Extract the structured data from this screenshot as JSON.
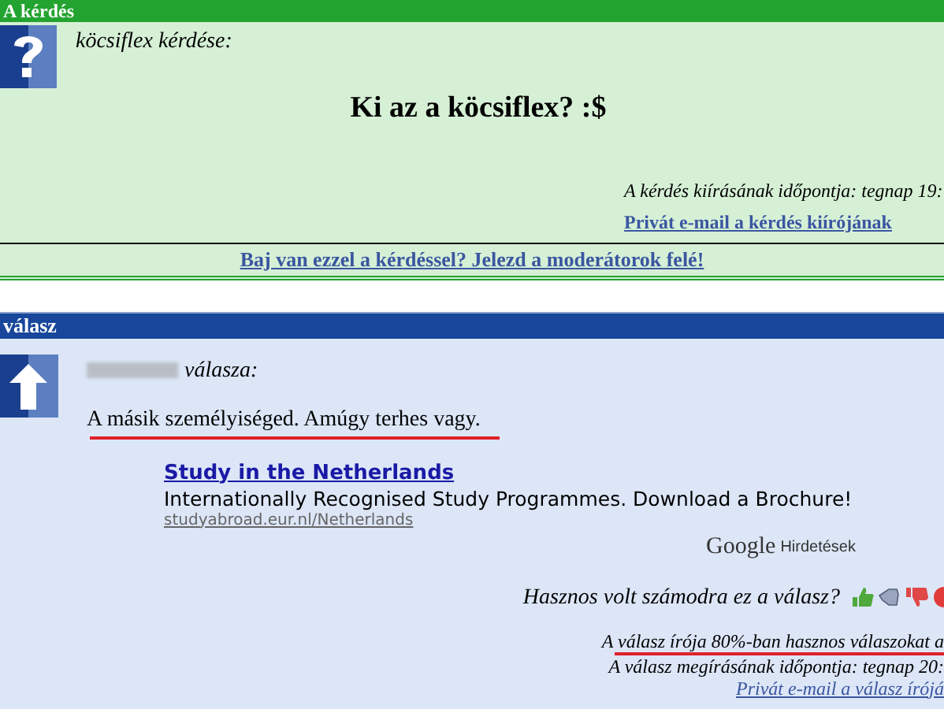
{
  "question": {
    "header": "A kérdés",
    "asker": "köcsiflex kérdése:",
    "title": "Ki az a köcsiflex? :$",
    "posted": "A kérdés kiírásának időpontja: tegnap 19:",
    "email_link": "Privát e-mail a kérdés kiírójának",
    "report_link": "Baj van ezzel a kérdéssel? Jelezd a moderátorok felé!"
  },
  "answer": {
    "header": "válasz",
    "author_label": "válasza:",
    "text": "A másik személyiséged. Amúgy terhes vagy.",
    "ad": {
      "title": "Study in the Netherlands",
      "description": "Internationally Recognised Study Programmes. Download a Brochure!",
      "url": "studyabroad.eur.nl/Netherlands",
      "brand": "Google",
      "brand_label": "Hirdetések"
    },
    "rating_prompt": "Hasznos volt számodra ez a válasz?",
    "stats": "A válasz írója 80%-ban hasznos válaszokat a",
    "posted": "A válasz megírásának időpontja: tegnap 20:",
    "email_link": "Privát e-mail a válasz írójá"
  }
}
